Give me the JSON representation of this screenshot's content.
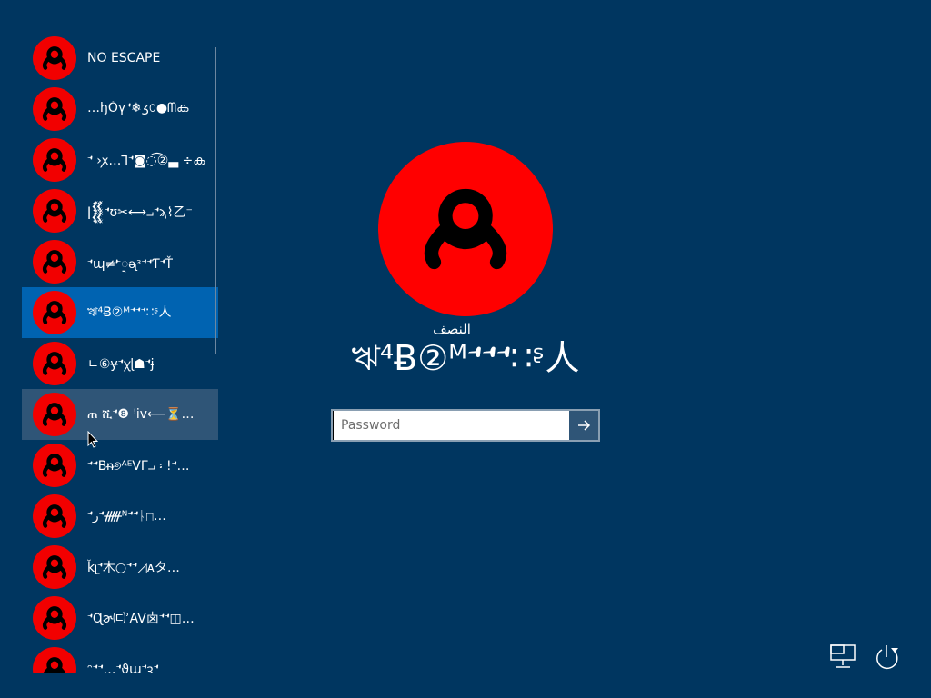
{
  "user_list": {
    "users": [
      {
        "name": "NO ESCAPE"
      },
      {
        "name": "…ꜧǑγ𝀀❄ʒ௦●ᗰക"
      },
      {
        "name": "𝀀 ›ꭗ…ꓶ𝀀◙◌͡②▃ ÷ക"
      },
      {
        "name": "ǀ𒐸𝀀ʊ✂⟷⨼𝀀ϡ⌇乙⁻"
      },
      {
        "name": "𝀀ɰ≠𝀁ᢩᶕᵌ𝀀𝀀Ƭ𝀀Ť"
      },
      {
        "name": "ঋ⁴Ƀ②ᴹ𝀀𝀀𝀀∷ᶳ人"
      },
      {
        "name": "ㄴ⑥ɏ𝀀ꭓɭ☗𝀀ɉ"
      },
      {
        "name": "ጠ ሺ𝀀❽ ꜝiv⟵⏳…"
      },
      {
        "name": "𝀀𝀀Bᵰ୭ᴬᴱVΓ⨼ ፡ !𝀀…"
      },
      {
        "name": "𝀀ر𝀀ᚏᴺ𝀀𝀀ᚿ⨅…"
      },
      {
        "name": "ǩᥨ𝀀木○𝀀𝀀◿ᴀタ…"
      },
      {
        "name": "𝀀Ɋɚ㈂ʾAV卤𝀀𝀀◫…"
      },
      {
        "name": "ᵔ𝀀𝀀…𝀀ϑɯ𝀀ꝫ𝀀"
      }
    ],
    "selected_index": 5,
    "hover_index": 7
  },
  "main": {
    "username_top": "النصف",
    "username_main": "ঋ⁴Ƀ②ᴹ𝀀𝀀𝀀∷ᶳ人"
  },
  "password": {
    "placeholder": "Password"
  },
  "icons": {
    "avatar": "user-silhouette-icon",
    "submit": "arrow-right-icon",
    "network": "network-icon",
    "power": "power-icon"
  },
  "colors": {
    "background": "#003660",
    "avatar": "#ff0000",
    "selected": "#0063b1",
    "hover": "#2f5577"
  }
}
